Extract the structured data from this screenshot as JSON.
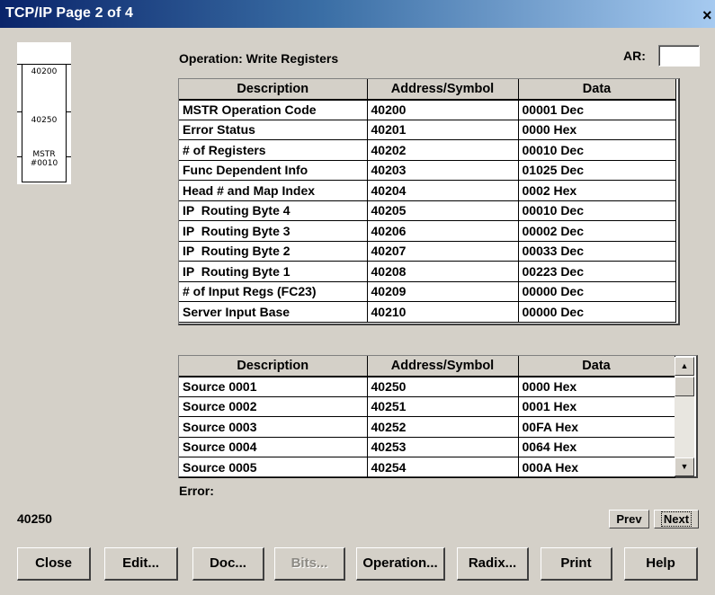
{
  "window": {
    "title": "TCP/IP Page 2 of 4",
    "close_glyph": "×"
  },
  "block": {
    "top_label": "40200",
    "mid_label": "40250",
    "bottom_label_1": "MSTR",
    "bottom_label_2": "#0010"
  },
  "operation": {
    "label": "Operation: Write Registers"
  },
  "ar": {
    "label": "AR:",
    "value": ""
  },
  "table1": {
    "headers": [
      "Description",
      "Address/Symbol",
      "Data"
    ],
    "rows": [
      [
        "MSTR Operation Code",
        "40200",
        "00001 Dec"
      ],
      [
        "Error Status",
        "40201",
        "0000 Hex"
      ],
      [
        "# of Registers",
        "40202",
        "00010 Dec"
      ],
      [
        "Func Dependent Info",
        "40203",
        "01025 Dec"
      ],
      [
        "Head # and Map Index",
        "40204",
        "0002 Hex"
      ],
      [
        "IP  Routing Byte 4",
        "40205",
        "00010 Dec"
      ],
      [
        "IP  Routing Byte 3",
        "40206",
        "00002 Dec"
      ],
      [
        "IP  Routing Byte 2",
        "40207",
        "00033 Dec"
      ],
      [
        "IP  Routing Byte 1",
        "40208",
        "00223 Dec"
      ],
      [
        "# of Input Regs (FC23)",
        "40209",
        "00000 Dec"
      ],
      [
        "Server Input Base",
        "40210",
        "00000 Dec"
      ]
    ]
  },
  "table2": {
    "headers": [
      "Description",
      "Address/Symbol",
      "Data"
    ],
    "rows": [
      [
        "Source 0001",
        "40250",
        "0000 Hex"
      ],
      [
        "Source 0002",
        "40251",
        "0001 Hex"
      ],
      [
        "Source 0003",
        "40252",
        "00FA Hex"
      ],
      [
        "Source 0004",
        "40253",
        "0064 Hex"
      ],
      [
        "Source 0005",
        "40254",
        "000A Hex"
      ]
    ]
  },
  "scrollbar": {
    "up_glyph": "▲",
    "down_glyph": "▼"
  },
  "error": {
    "label": "Error:"
  },
  "status": {
    "address": "40250"
  },
  "nav": {
    "prev_label": "Prev",
    "next_label": "Next"
  },
  "buttons": {
    "close": "Close",
    "edit": "Edit...",
    "doc": "Doc...",
    "bits": "Bits...",
    "operation": "Operation...",
    "radix": "Radix...",
    "print": "Print",
    "help": "Help"
  },
  "colors": {
    "title_start": "#0a246a",
    "title_end": "#a6caf0",
    "face": "#d4d0c8",
    "disabled_text": "#8c8a84"
  }
}
